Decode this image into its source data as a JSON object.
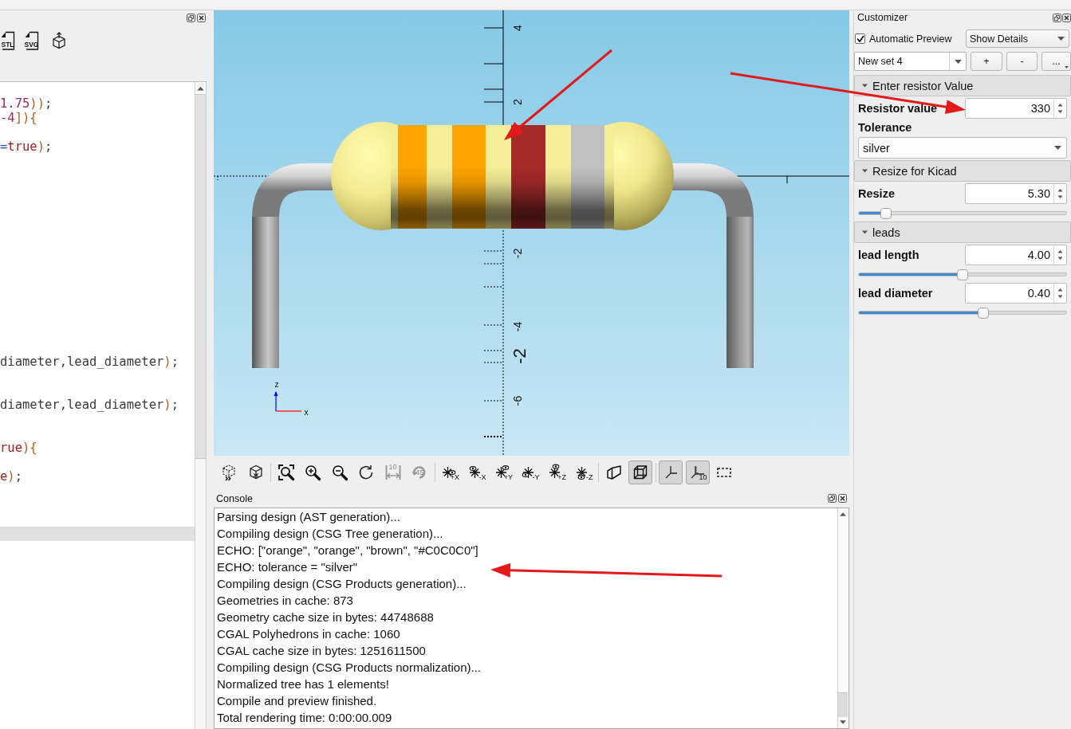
{
  "editor": {
    "toolbar": [
      {
        "kind": "export",
        "label": "STL"
      },
      {
        "kind": "export",
        "label": "SVG"
      },
      {
        "kind": "cube"
      }
    ],
    "lines": [
      {
        "kind": "blank",
        "current": false
      },
      {
        "kind": "code",
        "current": false,
        "tokens": [
          {
            "text": "1.75",
            "kind": "number"
          },
          {
            "text": "))",
            "kind": "bracket"
          },
          {
            "text": ";",
            "kind": "plain"
          }
        ]
      },
      {
        "kind": "code",
        "current": false,
        "tokens": [
          {
            "text": "-4",
            "kind": "number"
          },
          {
            "text": "]){",
            "kind": "bracket"
          }
        ]
      },
      {
        "kind": "blank",
        "current": false
      },
      {
        "kind": "code",
        "current": false,
        "tokens": [
          {
            "text": "=",
            "kind": "operator"
          },
          {
            "text": "true",
            "kind": "keyword"
          },
          {
            "text": ")",
            "kind": "bracket"
          },
          {
            "text": ";",
            "kind": "plain"
          }
        ]
      },
      {
        "kind": "blank",
        "current": false
      },
      {
        "kind": "blank",
        "current": false
      },
      {
        "kind": "blank",
        "current": false
      },
      {
        "kind": "blank",
        "current": false
      },
      {
        "kind": "blank",
        "current": false
      },
      {
        "kind": "blank",
        "current": false
      },
      {
        "kind": "blank",
        "current": false
      },
      {
        "kind": "blank",
        "current": false
      },
      {
        "kind": "blank",
        "current": false
      },
      {
        "kind": "blank",
        "current": false
      },
      {
        "kind": "blank",
        "current": false
      },
      {
        "kind": "blank",
        "current": false
      },
      {
        "kind": "blank",
        "current": false
      },
      {
        "kind": "blank",
        "current": false
      },
      {
        "kind": "code",
        "current": false,
        "tokens": [
          {
            "text": "diameter,lead_diameter",
            "kind": "plain"
          },
          {
            "text": ")",
            "kind": "bracket"
          },
          {
            "text": ";",
            "kind": "plain"
          }
        ]
      },
      {
        "kind": "blank",
        "current": false
      },
      {
        "kind": "blank",
        "current": false
      },
      {
        "kind": "code",
        "current": false,
        "tokens": [
          {
            "text": "diameter,lead_diameter",
            "kind": "plain"
          },
          {
            "text": ")",
            "kind": "bracket"
          },
          {
            "text": ";",
            "kind": "plain"
          }
        ]
      },
      {
        "kind": "blank",
        "current": false
      },
      {
        "kind": "blank",
        "current": false
      },
      {
        "kind": "code",
        "current": false,
        "tokens": [
          {
            "text": "rue",
            "kind": "keyword"
          },
          {
            "text": "){",
            "kind": "bracket"
          }
        ]
      },
      {
        "kind": "blank",
        "current": false
      },
      {
        "kind": "code",
        "current": false,
        "tokens": [
          {
            "text": "e",
            "kind": "keyword"
          },
          {
            "text": ")",
            "kind": "bracket"
          },
          {
            "text": ";",
            "kind": "plain"
          }
        ]
      },
      {
        "kind": "blank",
        "current": false
      },
      {
        "kind": "blank",
        "current": false
      },
      {
        "kind": "blank",
        "current": false
      },
      {
        "kind": "blank",
        "current": true
      }
    ]
  },
  "viewport": {
    "axis_labels": [
      {
        "text": "4",
        "kind": "tick"
      },
      {
        "text": "2",
        "kind": "tick"
      },
      {
        "text": "-2",
        "kind": "tick"
      },
      {
        "text": "-4",
        "kind": "tick"
      },
      {
        "text": "-2",
        "kind": "large"
      },
      {
        "text": "-6",
        "kind": "tick"
      }
    ],
    "resistor": {
      "bands": [
        {
          "color": "#ffa500"
        },
        {
          "color": "#ffa500"
        },
        {
          "color": "#a52a2a"
        },
        {
          "color": "#c0c0c0"
        }
      ]
    },
    "gizmo": {
      "z_label": "z",
      "x_label": "x"
    }
  },
  "view_toolbar": {
    "groups": [
      {
        "buttons": [
          {
            "kind": "preview",
            "pressed": false,
            "disabled": false
          },
          {
            "kind": "render",
            "pressed": false,
            "disabled": false
          }
        ]
      },
      {
        "buttons": [
          {
            "kind": "view-all",
            "pressed": false,
            "disabled": false
          },
          {
            "kind": "zoom-in",
            "pressed": false,
            "disabled": false
          },
          {
            "kind": "zoom-out",
            "pressed": false,
            "disabled": false
          },
          {
            "kind": "reset-view",
            "pressed": false,
            "disabled": false
          },
          {
            "kind": "measure",
            "badge": "10",
            "pressed": false,
            "disabled": true
          },
          {
            "kind": "rotate",
            "badge": "45",
            "pressed": false,
            "disabled": true
          }
        ]
      },
      {
        "buttons": [
          {
            "kind": "view-right",
            "badge": "+X",
            "pressed": false,
            "disabled": false
          },
          {
            "kind": "view-left",
            "badge": "-X",
            "pressed": false,
            "disabled": false
          },
          {
            "kind": "view-back",
            "badge": "+Y",
            "pressed": false,
            "disabled": false
          },
          {
            "kind": "view-front",
            "badge": "-Y",
            "pressed": false,
            "disabled": false
          },
          {
            "kind": "view-top",
            "badge": "+Z",
            "pressed": false,
            "disabled": false
          },
          {
            "kind": "view-bottom",
            "badge": "-Z",
            "pressed": false,
            "disabled": false
          }
        ]
      },
      {
        "buttons": [
          {
            "kind": "perspective",
            "pressed": false,
            "disabled": false
          },
          {
            "kind": "orthogonal",
            "pressed": true,
            "disabled": false
          }
        ]
      },
      {
        "buttons": [
          {
            "kind": "show-axes",
            "pressed": true,
            "disabled": false
          },
          {
            "kind": "show-scale",
            "badge": "10",
            "pressed": true,
            "disabled": false
          },
          {
            "kind": "show-edges",
            "pressed": false,
            "disabled": false
          }
        ]
      }
    ]
  },
  "console": {
    "title": "Console",
    "lines": [
      "Parsing design (AST generation)...",
      "Compiling design (CSG Tree generation)...",
      "ECHO: [\"orange\", \"orange\", \"brown\", \"#C0C0C0\"]",
      "ECHO: tolerance = \"silver\"",
      "Compiling design (CSG Products generation)...",
      "Geometries in cache: 873",
      "Geometry cache size in bytes: 44748688",
      "CGAL Polyhedrons in cache: 1060",
      "CGAL cache size in bytes: 1251611500",
      "Compiling design (CSG Products normalization)...",
      "Normalized tree has 1 elements!",
      "Compile and preview finished.",
      "Total rendering time: 0:00:00.009"
    ]
  },
  "customizer": {
    "title": "Customizer",
    "auto_preview": {
      "label": "Automatic Preview",
      "checked": true
    },
    "details": {
      "value": "Show Details"
    },
    "preset": {
      "value": "New set 4"
    },
    "preset_buttons": [
      "+",
      "-",
      "..."
    ],
    "groups": [
      {
        "title": "Enter resistor Value",
        "expanded": true,
        "params": [
          {
            "kind": "spinbox",
            "label": "Resistor value",
            "value": "330"
          },
          {
            "kind": "dropdown",
            "label": "Tolerance",
            "value": "silver"
          }
        ]
      },
      {
        "title": "Resize for Kicad",
        "expanded": true,
        "params": [
          {
            "kind": "slider",
            "label": "Resize",
            "value": "5.30",
            "level": 0.13
          }
        ]
      },
      {
        "title": "leads",
        "expanded": true,
        "params": [
          {
            "kind": "slider",
            "label": "lead length",
            "value": "4.00",
            "level": 0.5
          },
          {
            "kind": "slider",
            "label": "lead diameter",
            "value": "0.40",
            "level": 0.6
          }
        ]
      }
    ]
  },
  "annotations": [
    {
      "kind": "arrow"
    },
    {
      "kind": "arrow"
    },
    {
      "kind": "arrow"
    }
  ]
}
